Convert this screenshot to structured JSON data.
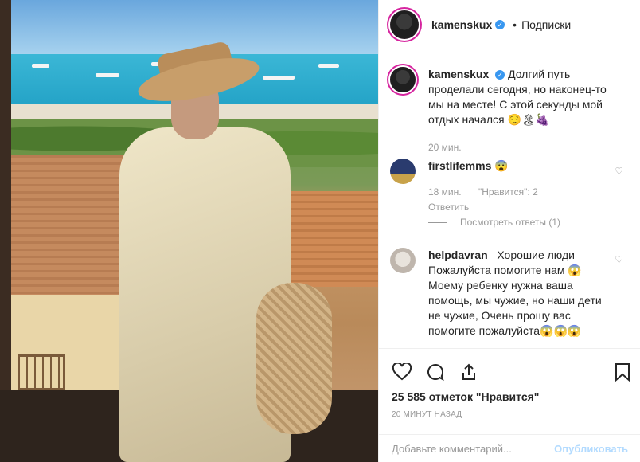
{
  "header": {
    "username": "kamenskux",
    "follow_label": "Подписки"
  },
  "caption": {
    "username": "kamenskux",
    "text": "Долгий путь проделали сегодня, но наконец-то мы на месте! С этой секунды мой отдых начался 😌🏝🍇",
    "time": "20 мин."
  },
  "comments": [
    {
      "username": "firstlifemms",
      "text": "😨",
      "time": "18 мин.",
      "likes": "\"Нравится\": 2",
      "reply": "Ответить",
      "view_replies": "Посмотреть ответы (1)"
    },
    {
      "username": "helpdavran_",
      "text": "Хорошие люди Пожалуйста помогите нам 😱 Моему ребенку нужна ваша помощь, мы чужие, но наши дети не чужие, Очень прошу вас помогите пожалуйста😱😱😱"
    }
  ],
  "actions": {
    "likes_text": "25 585 отметок \"Нравится\"",
    "posted_time": "20 МИНУТ НАЗАД",
    "comment_placeholder": "Добавьте комментарий...",
    "publish_label": "Опубликовать"
  },
  "icons": {
    "like": "heart-icon",
    "comment": "comment-icon",
    "share": "share-icon",
    "save": "bookmark-icon",
    "verified": "verified-badge-icon"
  },
  "colors": {
    "verified": "#3897f0",
    "publish_disabled": "#b3dbff",
    "secondary_text": "#999999"
  }
}
